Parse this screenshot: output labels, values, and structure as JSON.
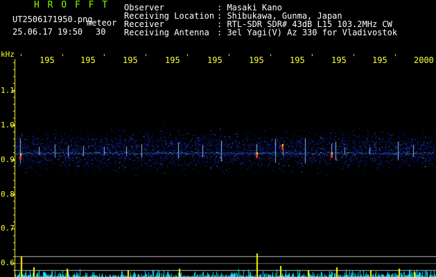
{
  "header": {
    "title": "H R O F F T",
    "filename": "UT2506171950.png",
    "type_label": "meteor",
    "date": "25.06.17 19:50",
    "count": "30",
    "rows": [
      {
        "label": "Observer",
        "value": ": Masaki Kano"
      },
      {
        "label": "Receiving Location",
        "value": ": Shibukawa, Gunma, Japan"
      },
      {
        "label": "Receiver",
        "value": ": RTL-SDR SDR# 43dB L15 103.2MHz CW"
      },
      {
        "label": "Receiving Antenna",
        "value": ": 3el Yagi(V) Az 330 for Vladivostok"
      }
    ]
  },
  "axis": {
    "unit": "kHz",
    "y_ticks": [
      "1.1",
      "1.0",
      "0.9",
      "0.8",
      "0.7",
      "0.6"
    ],
    "x_ticks": [
      "195",
      "195",
      "195",
      "195",
      "195",
      "195",
      "195",
      "195",
      "195",
      "2000"
    ]
  },
  "colors": {
    "label_green": "#7fff00",
    "tick_yellow": "#ffff33",
    "trace_cyan": "#00e5ff",
    "spike_yellow": "#ffff00",
    "noise_blue": "#1a2bd0"
  }
}
